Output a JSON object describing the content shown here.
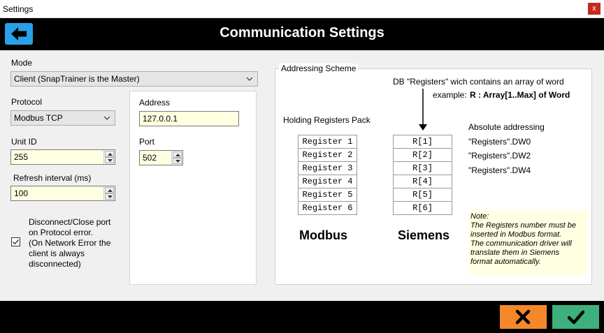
{
  "window": {
    "title": "Settings",
    "close_label": "x"
  },
  "header": {
    "title": "Communication Settings"
  },
  "mode": {
    "label": "Mode",
    "value": "Client (SnapTrainer is the Master)"
  },
  "protocol": {
    "label": "Protocol",
    "value": "Modbus TCP"
  },
  "unit_id": {
    "label": "Unit ID",
    "value": "255"
  },
  "refresh": {
    "label": "Refresh interval (ms)",
    "value": "100"
  },
  "disconnect": {
    "checked": true,
    "lines": [
      "Disconnect/Close port",
      "on Protocol error.",
      "(On Network Error the",
      "client is always",
      "disconnected)"
    ]
  },
  "address": {
    "label": "Address",
    "value": "127.0.0.1"
  },
  "port": {
    "label": "Port",
    "value": "502"
  },
  "scheme": {
    "legend": "Addressing Scheme",
    "db_text": "DB \"Registers\" wich contains an array of word",
    "example_label": "example:",
    "example_value": "R : Array[1..Max] of Word",
    "holding_label": "Holding Registers Pack",
    "absolute_label": "Absolute addressing",
    "modbus_registers": [
      "Register 1",
      "Register 2",
      "Register 3",
      "Register 4",
      "Register 5",
      "Register 6"
    ],
    "siemens_registers": [
      "R[1]",
      "R[2]",
      "R[3]",
      "R[4]",
      "R[5]",
      "R[6]"
    ],
    "absolute": [
      "\"Registers\".DW0",
      "\"Registers\".DW2",
      "\"Registers\".DW4"
    ],
    "modbus_title": "Modbus",
    "siemens_title": "Siemens",
    "note_lines": [
      "Note:",
      "The Registers number must be",
      "inserted in Modbus format.",
      "The communication driver will",
      "translate them in Siemens",
      "format automatically."
    ]
  },
  "colors": {
    "accent": "#2aa0e6",
    "cancel": "#f5882a",
    "ok": "#3db07d",
    "field_bg": "#ffffe1"
  },
  "icons": {
    "back": "arrow-left-icon",
    "cancel": "x-icon",
    "ok": "checkmark-icon"
  }
}
